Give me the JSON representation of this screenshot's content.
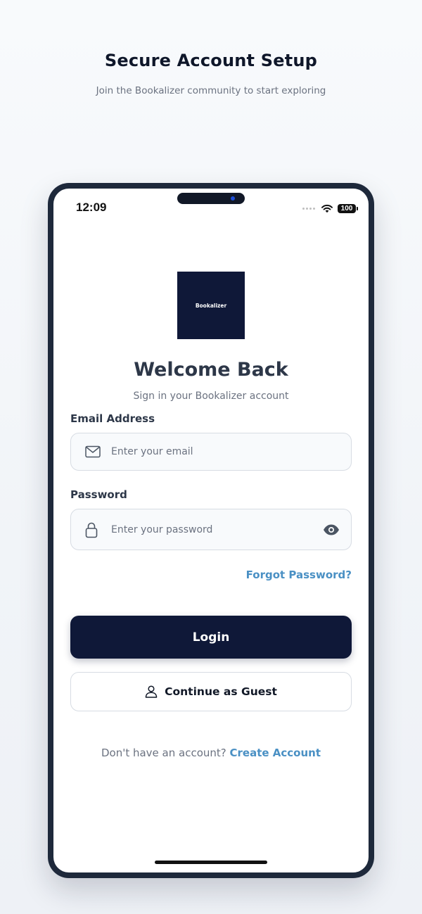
{
  "page": {
    "title": "Secure Account Setup",
    "subtitle": "Join the Bookalizer community to start exploring"
  },
  "status_bar": {
    "time": "12:09",
    "battery": "100",
    "icons": [
      "signal-dots-icon",
      "wifi-icon",
      "battery-icon"
    ]
  },
  "app": {
    "logo_text": "Bookalizer",
    "welcome_title": "Welcome Back",
    "welcome_subtitle": "Sign in your Bookalizer account"
  },
  "form": {
    "email": {
      "label": "Email Address",
      "placeholder": "Enter your email",
      "value": "",
      "icon": "mail-icon"
    },
    "password": {
      "label": "Password",
      "placeholder": "Enter your password",
      "value": "",
      "icon": "lock-icon",
      "toggle_icon": "eye-icon"
    },
    "forgot_password": "Forgot Password?",
    "login_label": "Login",
    "guest_label": "Continue as Guest",
    "guest_icon": "user-icon"
  },
  "signup": {
    "prompt": "Don't have an account?",
    "link": "Create Account"
  },
  "colors": {
    "primary": "#0f1838",
    "link": "#4a90c4",
    "heading": "#2d3748",
    "muted": "#6b7280",
    "frame": "#1e293b"
  }
}
